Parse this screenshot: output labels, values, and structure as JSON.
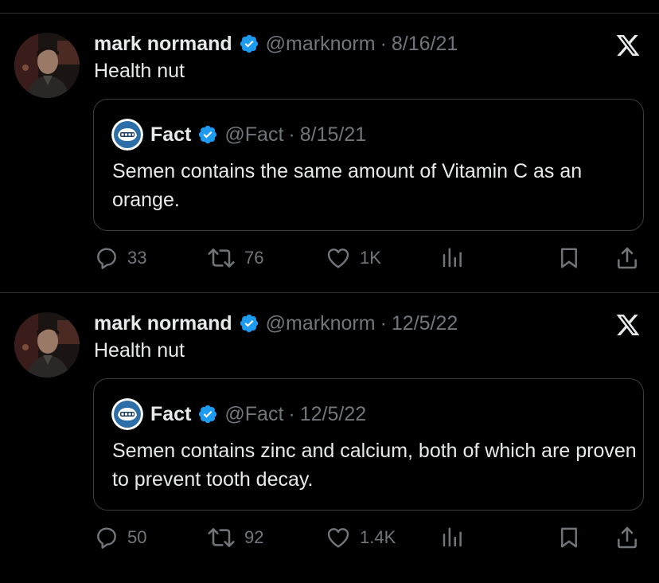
{
  "colors": {
    "background": "#000000",
    "text_primary": "#e7e9ea",
    "text_secondary": "#71767b",
    "verified_blue": "#1d9bf0",
    "border": "#3a3d40"
  },
  "tweets": [
    {
      "author": {
        "name": "mark normand",
        "handle": "@marknorm",
        "avatar": "avatar-photo",
        "verified": true
      },
      "separator": "·",
      "date": "8/16/21",
      "text": "Health nut",
      "platform_icon": "x-logo-icon",
      "quote": {
        "author": {
          "name": "Fact",
          "handle": "@Fact",
          "avatar": "fact-logo-avatar",
          "verified": true
        },
        "separator": "·",
        "date": "8/15/21",
        "text": "Semen contains the same amount of Vitamin C as an orange."
      },
      "actions": {
        "replies": "33",
        "retweets": "76",
        "likes": "1K"
      }
    },
    {
      "author": {
        "name": "mark normand",
        "handle": "@marknorm",
        "avatar": "avatar-photo",
        "verified": true
      },
      "separator": "·",
      "date": "12/5/22",
      "text": "Health nut",
      "platform_icon": "x-logo-icon",
      "quote": {
        "author": {
          "name": "Fact",
          "handle": "@Fact",
          "avatar": "fact-logo-avatar",
          "verified": true
        },
        "separator": "·",
        "date": "12/5/22",
        "text": "Semen contains zinc and calcium, both of which are proven to prevent tooth decay."
      },
      "actions": {
        "replies": "50",
        "retweets": "92",
        "likes": "1.4K"
      }
    }
  ]
}
